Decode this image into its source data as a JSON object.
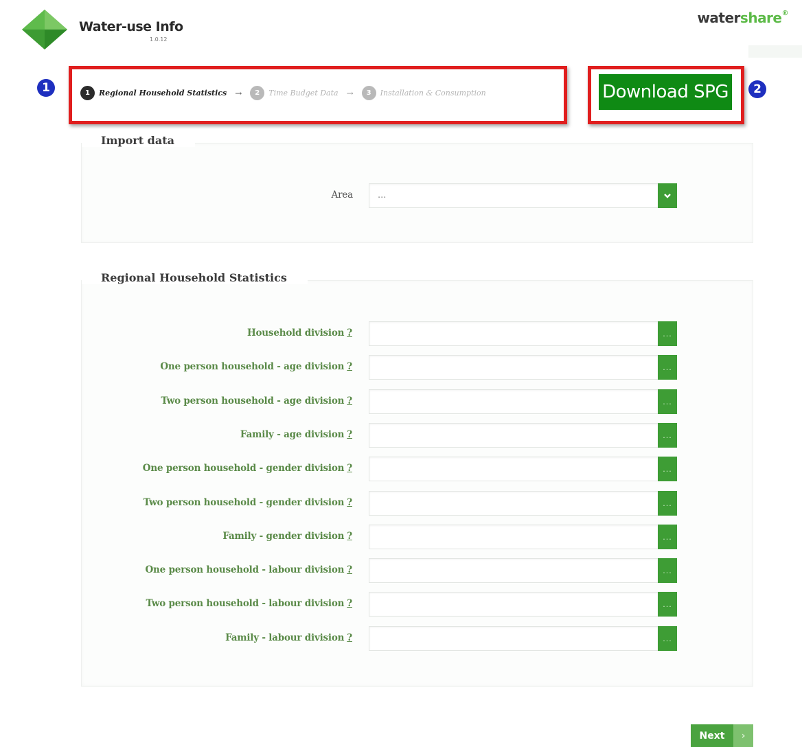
{
  "header": {
    "app_title": "Water-use Info",
    "app_version": "1.0.12",
    "brand_part1": "water",
    "brand_part2": "share",
    "brand_mark": "®"
  },
  "annotations": {
    "badge1": "1",
    "badge2": "2",
    "highlight_color": "#e01e1e",
    "badge_color": "#1e2fbf"
  },
  "wizard": {
    "steps": [
      {
        "number": "1",
        "label": "Regional Household Statistics",
        "state": "active"
      },
      {
        "number": "2",
        "label": "Time Budget Data",
        "state": "inactive"
      },
      {
        "number": "3",
        "label": "Installation & Consumption",
        "state": "inactive"
      }
    ],
    "arrow_glyph": "→"
  },
  "download_button": {
    "label": "Download SPG",
    "color": "#0f8a14"
  },
  "import_data": {
    "legend": "Import data",
    "area_label": "Area",
    "area_value": "...",
    "dropdown_icon": "chevron-down-icon"
  },
  "regional_stats": {
    "legend": "Regional Household Statistics",
    "help_marker": "?",
    "browse_label": "...",
    "fields": [
      {
        "label": "Household division"
      },
      {
        "label": "One person household - age division"
      },
      {
        "label": "Two person household - age division"
      },
      {
        "label": "Family - age division"
      },
      {
        "label": "One person household - gender division"
      },
      {
        "label": "Two person household - gender division"
      },
      {
        "label": "Family - gender division"
      },
      {
        "label": "One person household - labour division"
      },
      {
        "label": "Two person household - labour division"
      },
      {
        "label": "Family - labour division"
      }
    ]
  },
  "footer": {
    "next_label": "Next",
    "next_icon": "chevron-right-icon",
    "accent_color": "#4aa33f"
  }
}
